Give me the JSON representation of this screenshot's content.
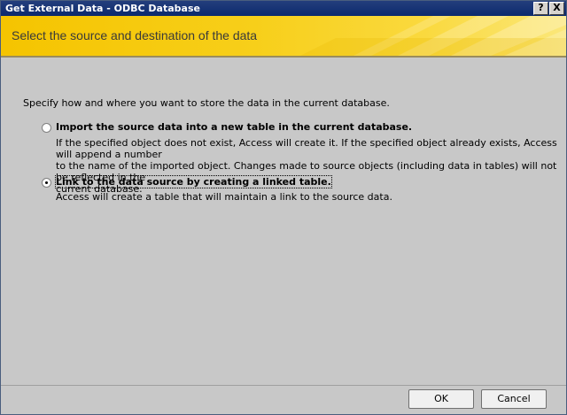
{
  "window": {
    "title": "Get External Data - ODBC Database",
    "help_button": "?",
    "close_button": "X"
  },
  "banner": {
    "title": "Select the source and destination of the data"
  },
  "instruction": "Specify how and where you want to store the data in the current database.",
  "options": [
    {
      "label": "Import the source data into a new table in the current database.",
      "description_lines": [
        "If the specified object does not exist, Access will create it. If the specified object already exists, Access will append a number",
        "to the name of the imported object. Changes made to source objects (including data in tables) will not be reflected in the",
        "current database."
      ],
      "selected": false
    },
    {
      "label": "Link to the data source by creating a linked table.",
      "description_lines": [
        "Access will create a table that will maintain a link to the source data."
      ],
      "selected": true
    }
  ],
  "buttons": {
    "ok": "OK",
    "cancel": "Cancel"
  },
  "colors": {
    "titlebar": "#0c2a6e",
    "banner": "#f7cf1a",
    "dialog_bg": "#c8c8c8"
  }
}
